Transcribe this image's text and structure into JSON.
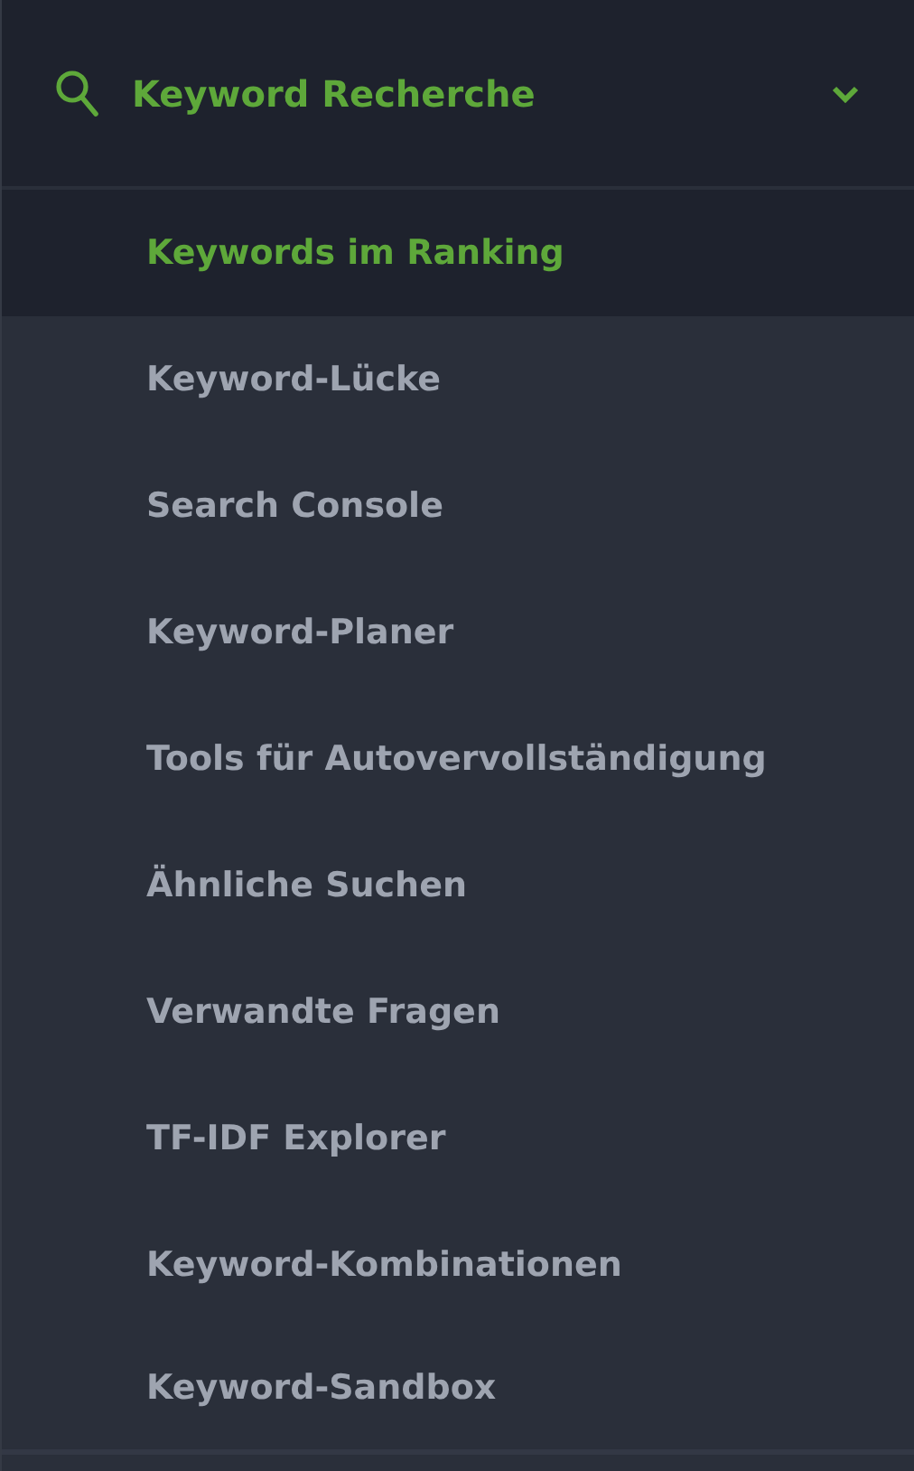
{
  "section": {
    "label": "Keyword Recherche",
    "expanded": true
  },
  "items": [
    {
      "label": "Keywords im Ranking",
      "selected": true
    },
    {
      "label": "Keyword-Lücke",
      "selected": false
    },
    {
      "label": "Search Console",
      "selected": false
    },
    {
      "label": "Keyword-Planer",
      "selected": false
    },
    {
      "label": "Tools für Autovervollständigung",
      "selected": false
    },
    {
      "label": "Ähnliche Suchen",
      "selected": false
    },
    {
      "label": "Verwandte Fragen",
      "selected": false
    },
    {
      "label": "TF-IDF Explorer",
      "selected": false
    },
    {
      "label": "Keyword-Kombinationen",
      "selected": false
    },
    {
      "label": "Keyword-Sandbox",
      "selected": false
    }
  ]
}
